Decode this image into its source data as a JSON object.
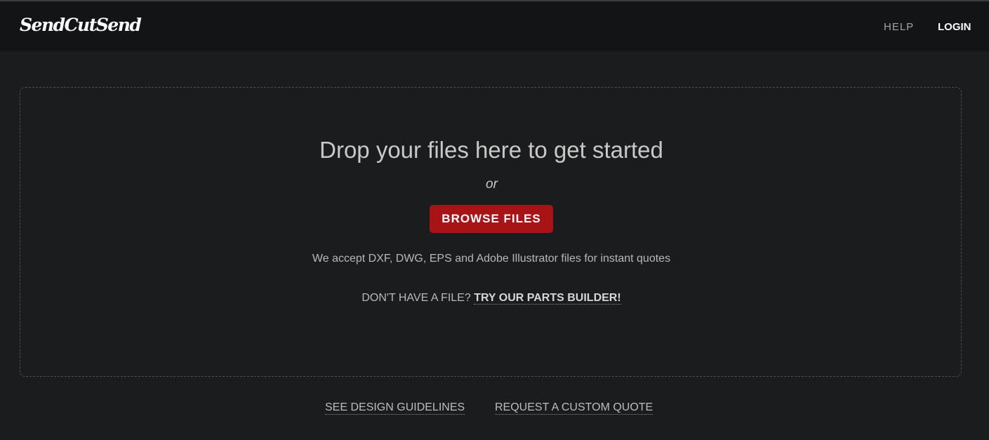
{
  "header": {
    "logo_text": "SendCutSend",
    "nav": {
      "help": "HELP",
      "login": "LOGIN"
    }
  },
  "dropzone": {
    "title": "Drop your files here to get started",
    "or_text": "or",
    "browse_label": "BROWSE FILES",
    "accept_text": "We accept DXF, DWG, EPS and Adobe Illustrator files for instant quotes",
    "no_file_text": "DON'T HAVE A FILE?",
    "parts_builder_link": "TRY OUR PARTS BUILDER!"
  },
  "footer": {
    "design_guidelines": "SEE DESIGN GUIDELINES",
    "custom_quote": "REQUEST A CUSTOM QUOTE"
  },
  "colors": {
    "background": "#1b1c1e",
    "header_background": "#131416",
    "accent": "#a81416"
  }
}
